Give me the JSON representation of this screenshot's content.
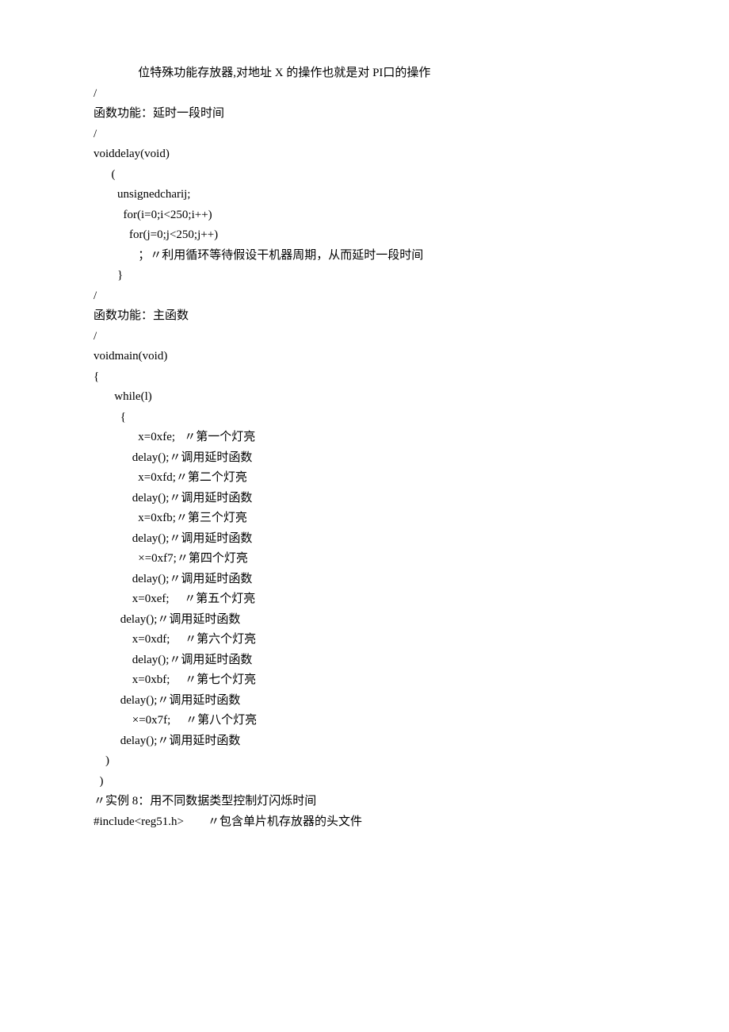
{
  "lines": {
    "l01": "               位特殊功能存放器,对地址 X 的操作也就是对 PI口的操作",
    "l02": "/",
    "l03": "函数功能：延时一段时间",
    "l04": "/",
    "l05": "voiddelay(void)",
    "l06": "      (",
    "l07": "        unsignedcharij;",
    "l08": "          for(i=0;i<250;i++)",
    "l09": "            for(j=0;j<250;j++)",
    "l10": "               ；〃利用循环等待假设干机器周期，从而延时一段时间",
    "l11": "        }",
    "l12": "/",
    "l13": "函数功能：主函数",
    "l14": "/",
    "l15": "voidmain(void)",
    "l16": "{",
    "l17": "       while(l)",
    "l18": "         {",
    "l19": "               x=0xfe;   〃第一个灯亮",
    "l20": "             delay();〃调用延时函数",
    "l21": "               x=0xfd;〃第二个灯亮",
    "l22": "             delay();〃调用延时函数",
    "l23": "               x=0xfb;〃第三个灯亮",
    "l24": "             delay();〃调用延时函数",
    "l25": "               ×=0xf7;〃第四个灯亮",
    "l26": "             delay();〃调用延时函数",
    "l27": "             x=0xef;     〃第五个灯亮",
    "l28": "         delay();〃调用延时函数",
    "l29": "             x=0xdf;     〃第六个灯亮",
    "l30": "             delay();〃调用延时函数",
    "l31": "             x=0xbf;     〃第七个灯亮",
    "l32": "         delay();〃调用延时函数",
    "l33": "             ×=0x7f;     〃第八个灯亮",
    "l34": "         delay();〃调用延时函数",
    "l35": "    )",
    "l36": "  )",
    "l37": "〃实例 8：用不同数据类型控制灯闪烁时间",
    "l38": "#include<reg51.h>        〃包含单片机存放器的头文件"
  }
}
